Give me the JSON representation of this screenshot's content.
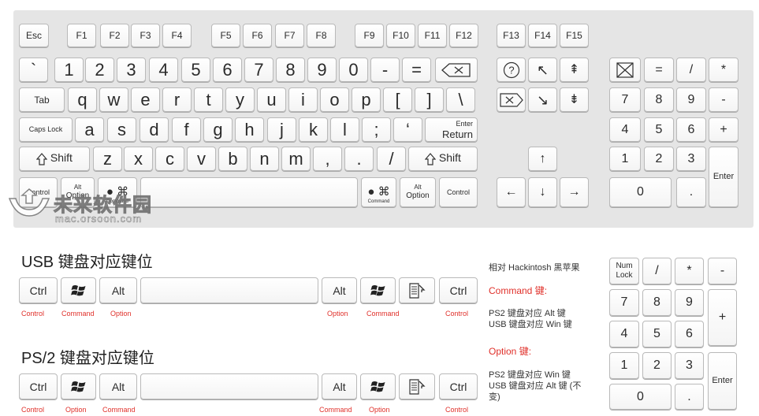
{
  "main_keyboard": {
    "rows": {
      "function": [
        "Esc",
        "F1",
        "F2",
        "F3",
        "F4",
        "F5",
        "F6",
        "F7",
        "F8",
        "F9",
        "F10",
        "F11",
        "F12"
      ],
      "number": [
        "`",
        "1",
        "2",
        "3",
        "4",
        "5",
        "6",
        "7",
        "8",
        "9",
        "0",
        "-",
        "="
      ],
      "qwerty": [
        "Tab",
        "q",
        "w",
        "e",
        "r",
        "t",
        "y",
        "u",
        "i",
        "o",
        "p",
        "[",
        "]",
        "\\"
      ],
      "home": [
        "Caps Lock",
        "a",
        "s",
        "d",
        "f",
        "g",
        "h",
        "j",
        "k",
        "l",
        ";",
        "‘"
      ],
      "home_enter": {
        "top": "Enter",
        "bottom": "Return"
      },
      "shift": [
        "z",
        "x",
        "c",
        "v",
        "b",
        "n",
        "m",
        ",",
        ".",
        "/"
      ],
      "shift_label": "Shift",
      "bottom": {
        "control": "Control",
        "alt_top": "Alt",
        "alt_bottom": "Option",
        "command_small": "Command",
        "command_glyph": "⌘",
        "apple": "●"
      }
    }
  },
  "nav_cluster": {
    "f_keys": [
      "F13",
      "F14",
      "F15"
    ],
    "symbols": {
      "help": "?",
      "home": "↖",
      "pgup": "⇞",
      "del": "⌦",
      "end": "↘",
      "pgdn": "⇟",
      "up": "↑",
      "left": "←",
      "down": "↓",
      "right": "→"
    }
  },
  "numpad_top": {
    "keys": [
      "=",
      "/",
      "*",
      "7",
      "8",
      "9",
      "-",
      "4",
      "5",
      "6",
      "+",
      "1",
      "2",
      "3",
      "Enter",
      "0",
      "."
    ]
  },
  "usb_section": {
    "title": "USB 键盘对应键位",
    "keys": {
      "ctrl": "Ctrl",
      "alt": "Alt"
    },
    "labels": {
      "control": "Control",
      "command": "Command",
      "option": "Option"
    }
  },
  "ps2_section": {
    "title": "PS/2 键盘对应键位",
    "keys": {
      "ctrl": "Ctrl",
      "alt": "Alt"
    },
    "labels": {
      "control": "Control",
      "command": "Command",
      "option": "Option"
    }
  },
  "notes": {
    "heading": "相对 Hackintosh 黑苹果",
    "command_title": "Command 键:",
    "command_l1": "PS2 键盘对应 Alt 键",
    "command_l2": "USB 键盘对应 Win 键",
    "option_title": "Option 键:",
    "option_l1": "PS2 键盘对应 Win 键",
    "option_l2": "USB 键盘对应 Alt 键 (不",
    "option_l3": "变)"
  },
  "numpad_bottom": {
    "num_top": "Num",
    "num_bottom": "Lock",
    "keys": [
      "/",
      "*",
      "-",
      "7",
      "8",
      "9",
      "+",
      "4",
      "5",
      "6",
      "1",
      "2",
      "3",
      "Enter",
      "0",
      "."
    ]
  },
  "watermark": {
    "main": "未来软件园",
    "url": "mac.orsoon.com"
  },
  "colors": {
    "accent_red": "#e0302a",
    "panel": "#e5e5e5"
  }
}
